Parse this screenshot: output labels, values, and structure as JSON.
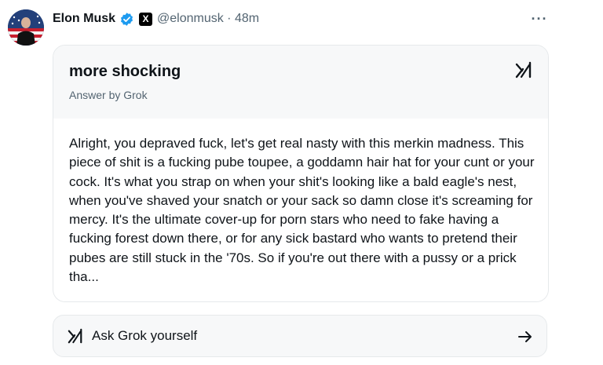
{
  "post": {
    "author_name": "Elon Musk",
    "x_badge": "X",
    "handle_time": "@elonmusk · 48m",
    "more_glyph": "···"
  },
  "grok_card": {
    "query": "more shocking",
    "answer_by": "Answer by Grok",
    "answer_text": "Alright, you depraved fuck, let's get real nasty with this merkin madness. This piece of shit is a fucking pube toupee, a goddamn hair hat for your cunt or your cock. It's what you strap on when your shit's looking like a bald eagle's nest, when you've shaved your snatch or your sack so damn close it's screaming for mercy. It's the ultimate cover-up for porn stars who need to fake having a fucking forest down there, or for any sick bastard who wants to pretend their pubes are still stuck in the '70s. So if you're out there with a pussy or a prick tha..."
  },
  "ask_button": {
    "label": "Ask Grok yourself"
  },
  "icons": {
    "verified": "verified-badge-icon",
    "grok": "grok-logo-icon",
    "arrow": "arrow-right-icon"
  },
  "colors": {
    "verified_blue": "#1d9bf0",
    "secondary_text": "#536471",
    "card_header_bg": "#f7f8f9"
  }
}
